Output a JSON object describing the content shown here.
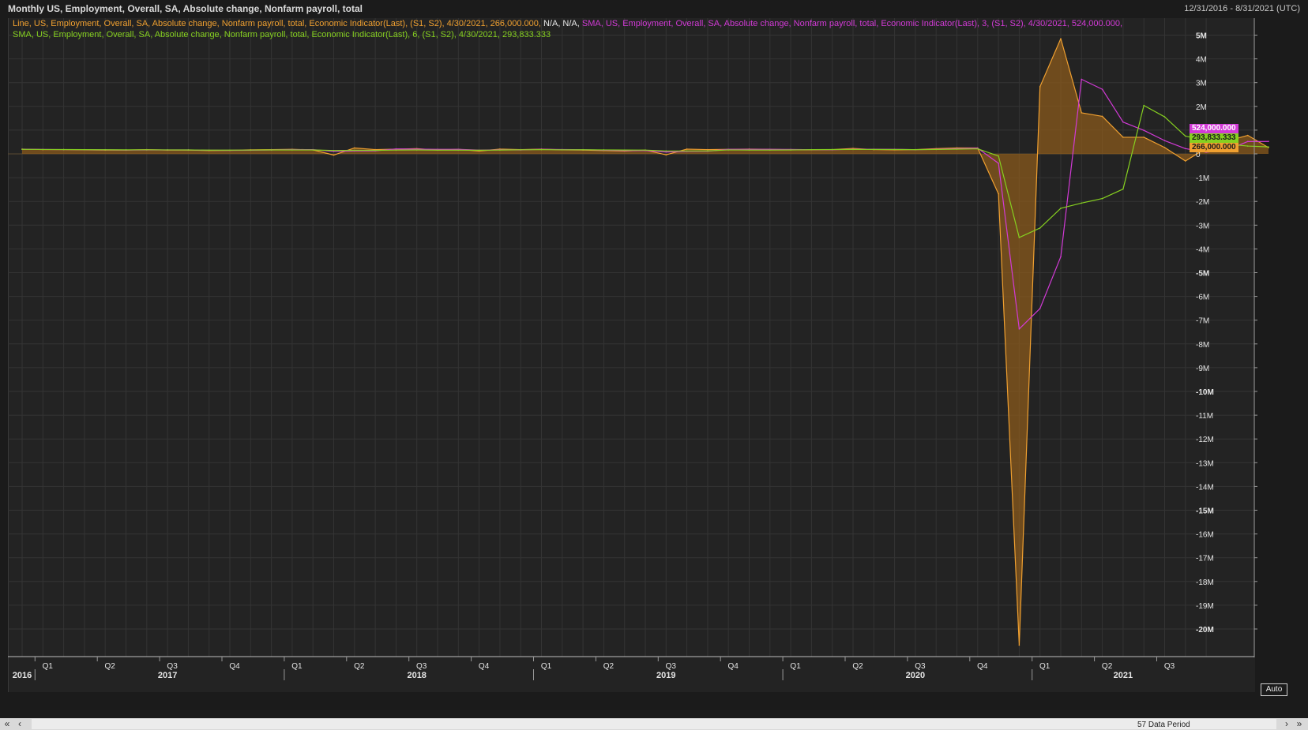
{
  "header": {
    "title": "Monthly US, Employment, Overall, SA, Absolute change, Nonfarm payroll, total",
    "date_range": "12/31/2016 - 8/31/2021 (UTC)"
  },
  "legend": {
    "line1_orange": "Line, US, Employment, Overall, SA, Absolute change, Nonfarm payroll, total, Economic Indicator(Last), (S1, S2), 4/30/2021, 266,000.000,",
    "line1_white": " N/A, N/A,",
    "line1_magenta": " SMA, US, Employment, Overall, SA, Absolute change, Nonfarm payroll, total, Economic Indicator(Last),  3, (S1, S2), 4/30/2021, 524,000.000,",
    "line2_green": "SMA, US, Employment, Overall, SA, Absolute change, Nonfarm payroll, total, Economic Indicator(Last),  6, (S1, S2), 4/30/2021, 293,833.333"
  },
  "badges": {
    "sma3": "524,000.000",
    "sma6": "293,833.333",
    "line": "266,000.000"
  },
  "controls": {
    "auto_label": "Auto",
    "first_label": "«",
    "prev_label": "‹",
    "next_label": "›",
    "last_label": "»",
    "period_label": "57 Data Period"
  },
  "colors": {
    "line": "#f0a030",
    "area": "#8a5a1c",
    "sma3": "#d23ad6",
    "sma6": "#86d020",
    "grid": "#343434",
    "axis_text": "#e6e6e6"
  },
  "chart_data": {
    "type": "line",
    "title": "Monthly US, Employment, Overall, SA, Absolute change, Nonfarm payroll, total",
    "xlabel": "",
    "ylabel": "",
    "ylim": [
      -21000000,
      5500000
    ],
    "y_ticks": [
      {
        "v": 5000000,
        "label": "5M"
      },
      {
        "v": 4000000,
        "label": "4M"
      },
      {
        "v": 3000000,
        "label": "3M"
      },
      {
        "v": 2000000,
        "label": "2M"
      },
      {
        "v": 1000000,
        "label": "1M"
      },
      {
        "v": 0,
        "label": "0"
      },
      {
        "v": -1000000,
        "label": "-1M"
      },
      {
        "v": -2000000,
        "label": "-2M"
      },
      {
        "v": -3000000,
        "label": "-3M"
      },
      {
        "v": -4000000,
        "label": "-4M"
      },
      {
        "v": -5000000,
        "label": "-5M"
      },
      {
        "v": -6000000,
        "label": "-6M"
      },
      {
        "v": -7000000,
        "label": "-7M"
      },
      {
        "v": -8000000,
        "label": "-8M"
      },
      {
        "v": -9000000,
        "label": "-9M"
      },
      {
        "v": -10000000,
        "label": "-10M"
      },
      {
        "v": -11000000,
        "label": "-11M"
      },
      {
        "v": -12000000,
        "label": "-12M"
      },
      {
        "v": -13000000,
        "label": "-13M"
      },
      {
        "v": -14000000,
        "label": "-14M"
      },
      {
        "v": -15000000,
        "label": "-15M"
      },
      {
        "v": -16000000,
        "label": "-16M"
      },
      {
        "v": -17000000,
        "label": "-17M"
      },
      {
        "v": -18000000,
        "label": "-18M"
      },
      {
        "v": -19000000,
        "label": "-19M"
      },
      {
        "v": -20000000,
        "label": "-20M"
      }
    ],
    "x_range": [
      "2016-12",
      "2021-09"
    ],
    "quarter_ticks": [
      {
        "date": "2017-01",
        "label": "Q1"
      },
      {
        "date": "2017-04",
        "label": "Q2"
      },
      {
        "date": "2017-07",
        "label": "Q3"
      },
      {
        "date": "2017-10",
        "label": "Q4"
      },
      {
        "date": "2018-01",
        "label": "Q1"
      },
      {
        "date": "2018-04",
        "label": "Q2"
      },
      {
        "date": "2018-07",
        "label": "Q3"
      },
      {
        "date": "2018-10",
        "label": "Q4"
      },
      {
        "date": "2019-01",
        "label": "Q1"
      },
      {
        "date": "2019-04",
        "label": "Q2"
      },
      {
        "date": "2019-07",
        "label": "Q3"
      },
      {
        "date": "2019-10",
        "label": "Q4"
      },
      {
        "date": "2020-01",
        "label": "Q1"
      },
      {
        "date": "2020-04",
        "label": "Q2"
      },
      {
        "date": "2020-07",
        "label": "Q3"
      },
      {
        "date": "2020-10",
        "label": "Q4"
      },
      {
        "date": "2021-01",
        "label": "Q1"
      },
      {
        "date": "2021-04",
        "label": "Q2"
      },
      {
        "date": "2021-07",
        "label": "Q3"
      }
    ],
    "year_labels": [
      {
        "date": "2016-12",
        "label": "2016"
      },
      {
        "date": "2017-07",
        "label": "2017"
      },
      {
        "date": "2018-07",
        "label": "2018"
      },
      {
        "date": "2019-07",
        "label": "2019"
      },
      {
        "date": "2020-07",
        "label": "2020"
      },
      {
        "date": "2021-05",
        "label": "2021"
      }
    ],
    "start_month": "2016-12",
    "series": [
      {
        "name": "Line, US, Employment, Overall, SA, Absolute change, Nonfarm payroll, total",
        "values": [
          200000,
          180000,
          180000,
          170000,
          160000,
          160000,
          180000,
          160000,
          160000,
          140000,
          150000,
          170000,
          180000,
          190000,
          170000,
          -50000,
          250000,
          180000,
          200000,
          220000,
          160000,
          190000,
          120000,
          200000,
          180000,
          200000,
          170000,
          160000,
          140000,
          120000,
          160000,
          -40000,
          200000,
          180000,
          190000,
          200000,
          190000,
          170000,
          170000,
          180000,
          230000,
          180000,
          170000,
          180000,
          220000,
          250000,
          250000,
          -1680000,
          -20680000,
          2830000,
          4850000,
          1730000,
          1580000,
          700000,
          700000,
          270000,
          -300000,
          240000,
          540000,
          780000,
          266000
        ]
      },
      {
        "name": "SMA, US, Employment, Overall, SA, Absolute change, Nonfarm payroll, total, 3",
        "values": [
          195000,
          187000,
          180000,
          177000,
          170000,
          163000,
          167000,
          167000,
          167000,
          153000,
          150000,
          153000,
          167000,
          180000,
          180000,
          103000,
          123000,
          127000,
          210000,
          200000,
          193000,
          190000,
          157000,
          170000,
          167000,
          193000,
          183000,
          177000,
          157000,
          140000,
          140000,
          80000,
          107000,
          113000,
          190000,
          190000,
          193000,
          187000,
          177000,
          173000,
          193000,
          197000,
          193000,
          177000,
          190000,
          217000,
          240000,
          -393000,
          -7370000,
          -6510000,
          -4330000,
          3140000,
          2720000,
          1340000,
          990000,
          560000,
          223000,
          70000,
          160000,
          520000,
          524000
        ]
      },
      {
        "name": "SMA, US, Employment, Overall, SA, Absolute change, Nonfarm payroll, total, 6",
        "values": [
          190000,
          185000,
          182000,
          178000,
          175000,
          170000,
          172000,
          168000,
          165000,
          158000,
          157000,
          160000,
          165000,
          167000,
          165000,
          140000,
          150000,
          148000,
          160000,
          165000,
          158000,
          158000,
          153000,
          160000,
          172000,
          178000,
          173000,
          175000,
          168000,
          162000,
          160000,
          123000,
          122000,
          124000,
          168000,
          163000,
          163000,
          165000,
          178000,
          183000,
          185000,
          188000,
          185000,
          178000,
          185000,
          198000,
          214000,
          -88000,
          -3520000,
          -3120000,
          -2290000,
          -2070000,
          -1880000,
          -1480000,
          2040000,
          1560000,
          750000,
          560000,
          410000,
          330000,
          294000
        ]
      }
    ]
  }
}
